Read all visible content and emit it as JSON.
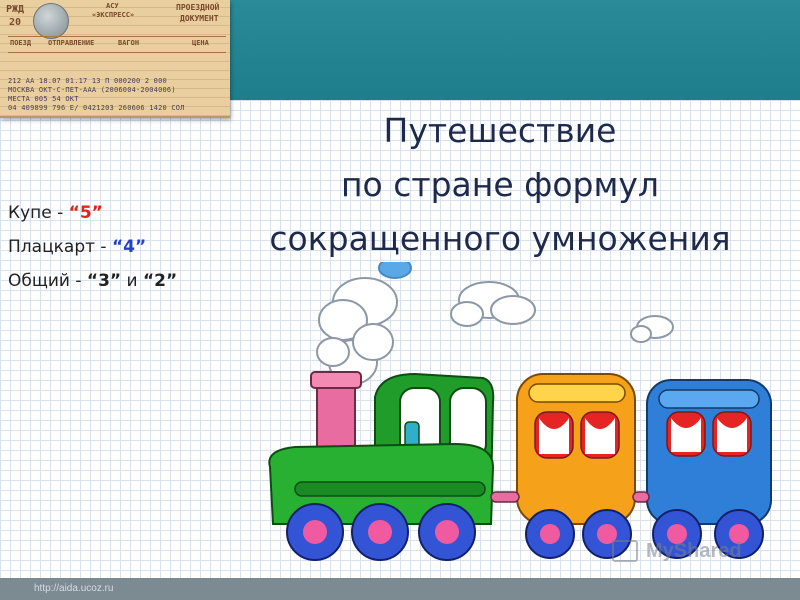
{
  "slide": {
    "title_lines": [
      "Путешествие",
      "по стране формул",
      "сокращенного умножения"
    ],
    "tickets": {
      "row1_label": "Купе - ",
      "row1_value": "“5”",
      "row2_label": "Плацкарт - ",
      "row2_value": "“4”",
      "row3_label": "Общий - ",
      "row3_value1": "“3”",
      "row3_conj": " и ",
      "row3_value2": "“2”"
    },
    "footer_url": "http://aida.ucoz.ru",
    "watermark": "MyShared"
  },
  "ticket_image": {
    "railway": "РЖД",
    "number": "20",
    "asu": "АСУ",
    "express": "«ЭКСПРЕСС»",
    "doc_title_1": "ПРОЕЗДНОЙ",
    "doc_title_2": "ДОКУМЕНТ",
    "col_train": "ПОЕЗД",
    "col_departure": "ОТПРАВЛЕНИЕ",
    "col_car": "ВАГОН",
    "col_price": "ЦЕНА",
    "line1": "212 АА    18.07 01.17   13 П  000200 2 000",
    "line2": "МОСКВА ОКТ-С-ПЕТ-ААА (2006004-2004006)",
    "line3": "МЕСТА 005 54 ОКТ",
    "line4": "04 409899 796 Е/ 0421203 260606 1420 СОЛ"
  },
  "colors": {
    "top_band": "#2a8a97",
    "title_text": "#1f2a4a",
    "coupe_value": "#e2231a",
    "platzkart_value": "#2342c8",
    "locomotive": "#1f9c2a",
    "car_orange": "#f5a21a",
    "car_blue": "#2f7fd8",
    "footer": "#7c8a92"
  }
}
